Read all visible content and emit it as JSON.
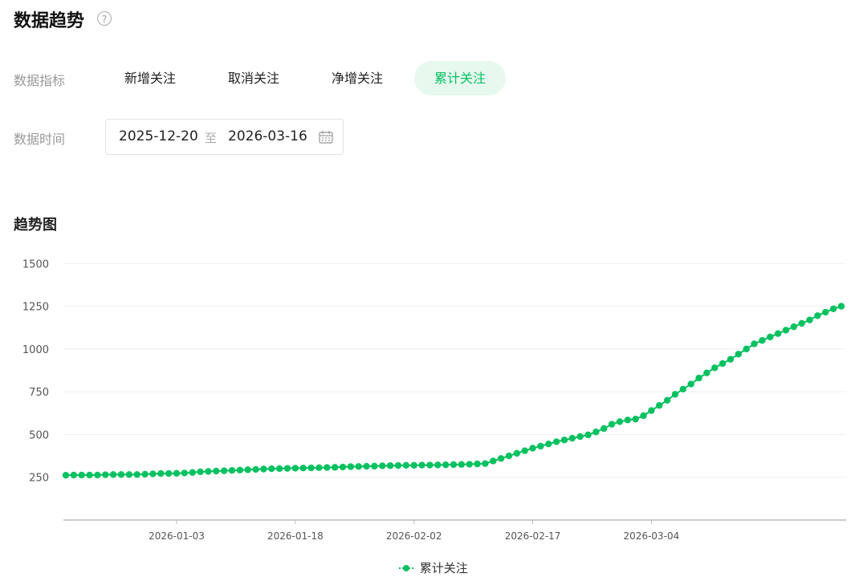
{
  "header": {
    "title": "数据趋势",
    "help_icon": "question-circle-icon"
  },
  "metrics": {
    "label": "数据指标",
    "tabs": [
      {
        "label": "新增关注",
        "active": false
      },
      {
        "label": "取消关注",
        "active": false
      },
      {
        "label": "净增关注",
        "active": false
      },
      {
        "label": "累计关注",
        "active": true
      }
    ]
  },
  "date_range": {
    "label": "数据时间",
    "start": "2025-12-20",
    "separator": "至",
    "end": "2026-03-16",
    "icon": "calendar-icon"
  },
  "section_title": "趋势图",
  "colors": {
    "accent": "#07c160",
    "active_tab_bg": "#e7f8ee"
  },
  "chart_data": {
    "type": "line",
    "start_date": "2025-12-20",
    "x_ticks": [
      "2026-01-03",
      "2026-01-18",
      "2026-02-02",
      "2026-02-17",
      "2026-03-04"
    ],
    "y_ticks": [
      250,
      500,
      750,
      1000,
      1250,
      1500
    ],
    "ylim": [
      0,
      1500
    ],
    "grid": true,
    "legend": "bottom",
    "series": [
      {
        "name": "累计关注",
        "color": "#07c160",
        "values": [
          262,
          263,
          263,
          263,
          263,
          265,
          266,
          266,
          266,
          266,
          268,
          270,
          272,
          272,
          273,
          275,
          278,
          282,
          284,
          286,
          288,
          290,
          292,
          294,
          296,
          298,
          300,
          301,
          302,
          303,
          304,
          305,
          306,
          307,
          308,
          310,
          312,
          313,
          314,
          315,
          317,
          318,
          319,
          320,
          320,
          321,
          321,
          322,
          323,
          324,
          325,
          326,
          328,
          330,
          345,
          360,
          375,
          390,
          405,
          420,
          432,
          445,
          458,
          468,
          478,
          488,
          498,
          515,
          535,
          560,
          575,
          585,
          590,
          610,
          640,
          670,
          700,
          735,
          765,
          795,
          830,
          860,
          890,
          915,
          940,
          970,
          1000,
          1030,
          1050,
          1070,
          1090,
          1110,
          1130,
          1150,
          1170,
          1195,
          1215,
          1235,
          1250
        ]
      }
    ]
  }
}
